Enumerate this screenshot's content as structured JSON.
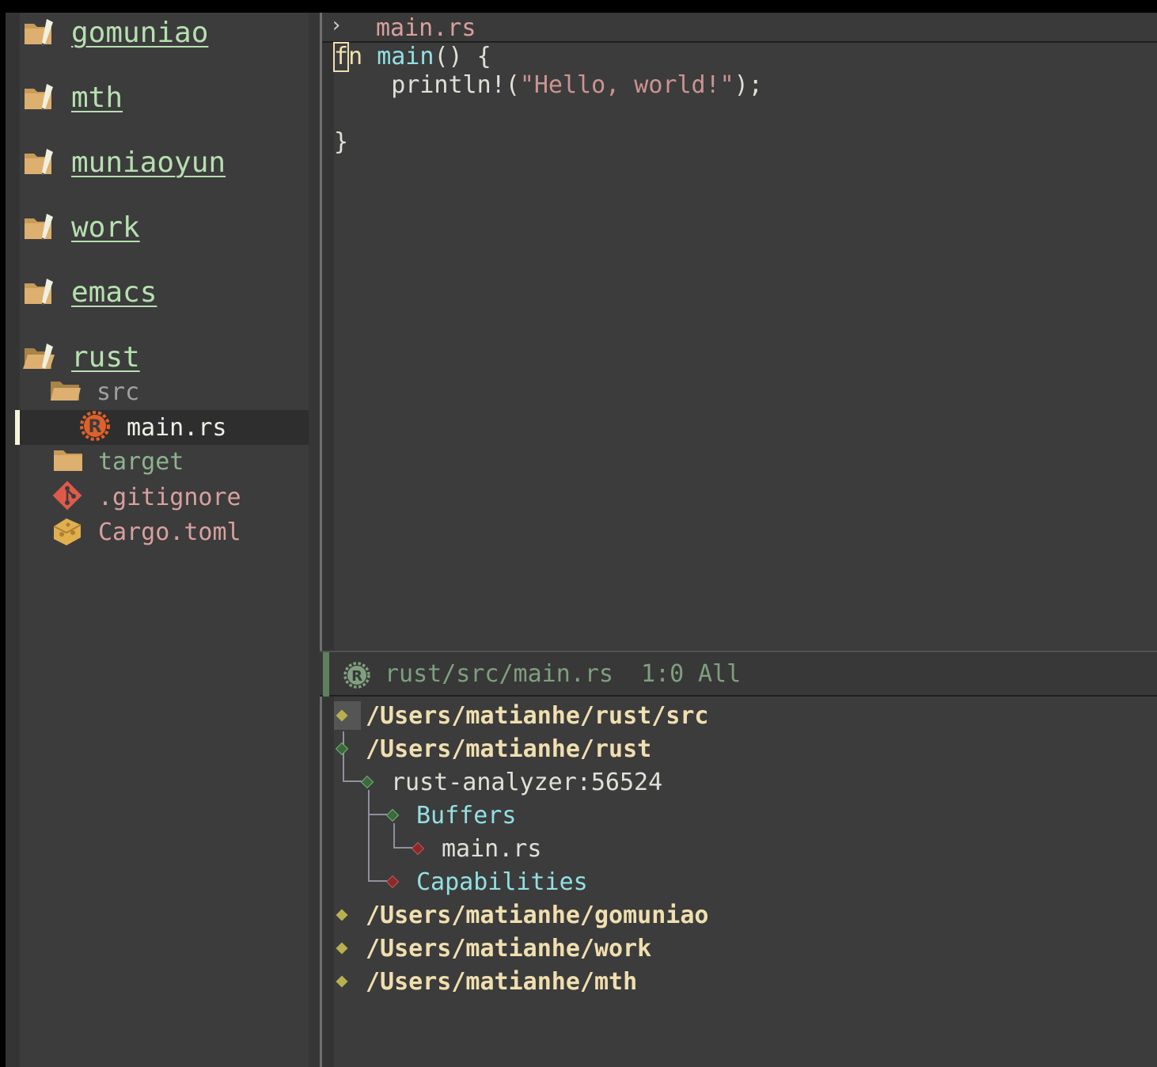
{
  "sidebar": {
    "workspaces": [
      {
        "label": "gomuniao"
      },
      {
        "label": "mth"
      },
      {
        "label": "muniaoyun"
      },
      {
        "label": "work"
      },
      {
        "label": "emacs"
      },
      {
        "label": "rust"
      }
    ],
    "tree": {
      "src": "src",
      "main_rs": "main.rs",
      "target": "target",
      "gitignore": ".gitignore",
      "cargo": "Cargo.toml"
    }
  },
  "editor": {
    "header_file": "main.rs",
    "code": {
      "kw_cursor": "f",
      "kw_rest": "n",
      "fn_name": "main",
      "sig_rest": "() {",
      "macro": "    println!(",
      "string": "\"Hello, world!\"",
      "stmt_end": ");",
      "close": "}"
    }
  },
  "modeline": {
    "path": "rust/src/main.rs",
    "position": "1:0",
    "scope": "All"
  },
  "lsp_tree": {
    "rows": [
      {
        "label": "/Users/matianhe/rust/src"
      },
      {
        "label": "/Users/matianhe/rust"
      },
      {
        "label": "rust-analyzer:56524"
      },
      {
        "label": "Buffers"
      },
      {
        "label": "main.rs"
      },
      {
        "label": "Capabilities"
      },
      {
        "label": "/Users/matianhe/gomuniao"
      },
      {
        "label": "/Users/matianhe/work"
      },
      {
        "label": "/Users/matianhe/mth"
      }
    ]
  },
  "colors": {
    "background": "#3c3c3c",
    "workspace_label": "#b6e0b0",
    "keyword": "#f0dfaf",
    "function": "#93e0e3",
    "string": "#cc9393",
    "modeline_text": "#7f9f7f"
  }
}
